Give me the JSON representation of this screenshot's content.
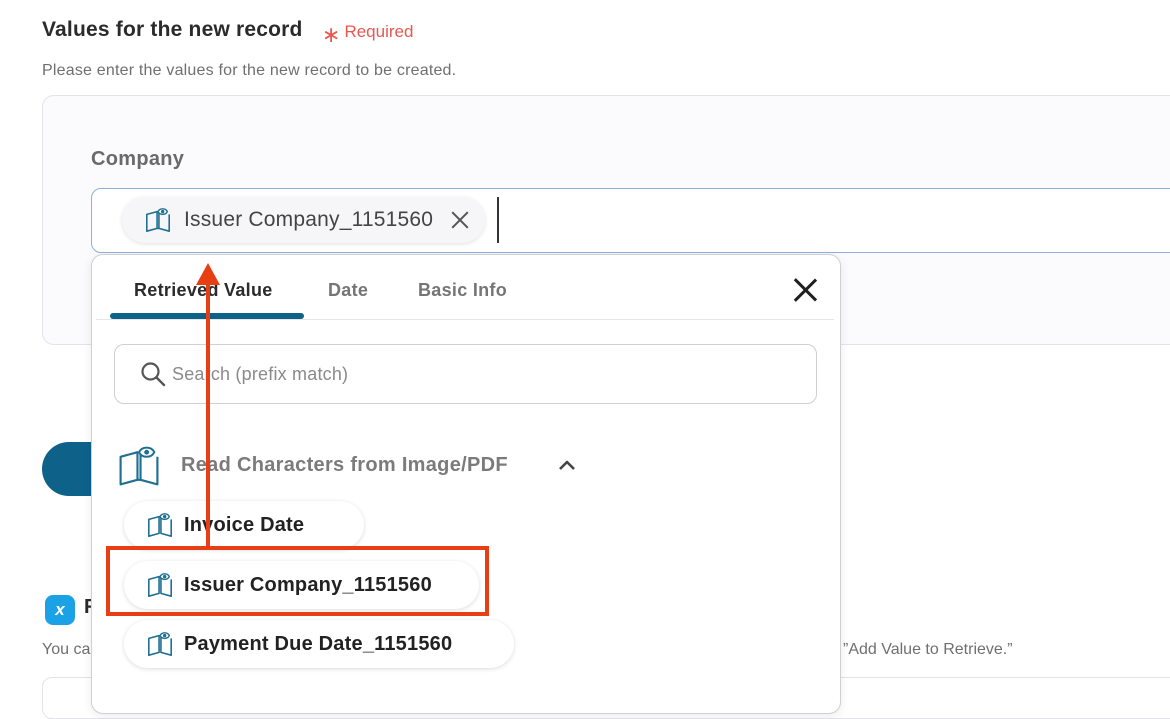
{
  "section": {
    "title": "Values for the new record",
    "required": "Required",
    "description": "Please enter the values for the new record to be created."
  },
  "company": {
    "label": "Company",
    "chip_value": "Issuer Company_1151560"
  },
  "picker": {
    "tabs": [
      "Retrieved Value",
      "Date",
      "Basic Info"
    ],
    "active_tab": "Retrieved Value",
    "search_placeholder": "Search (prefix match)",
    "group_title": "Read Characters from Image/PDF",
    "items": [
      "Invoice Date",
      "Issuer Company_1151560",
      "Payment Due Date_1151560"
    ],
    "highlighted_item": "Issuer Company_1151560"
  },
  "background": {
    "icon_letter": "x",
    "heading_fragment": "F",
    "desc_start": "You ca",
    "desc_end": "”Add Value to Retrieve.”"
  },
  "colors": {
    "accent": "#0e6289",
    "required": "#e8574f",
    "annotation": "#e83e14",
    "icon_blue": "#1f6f93"
  },
  "icons": {
    "value_icon": "book-eye-icon",
    "search": "search-icon",
    "close": "close-icon",
    "collapse": "chevron-up-icon"
  }
}
